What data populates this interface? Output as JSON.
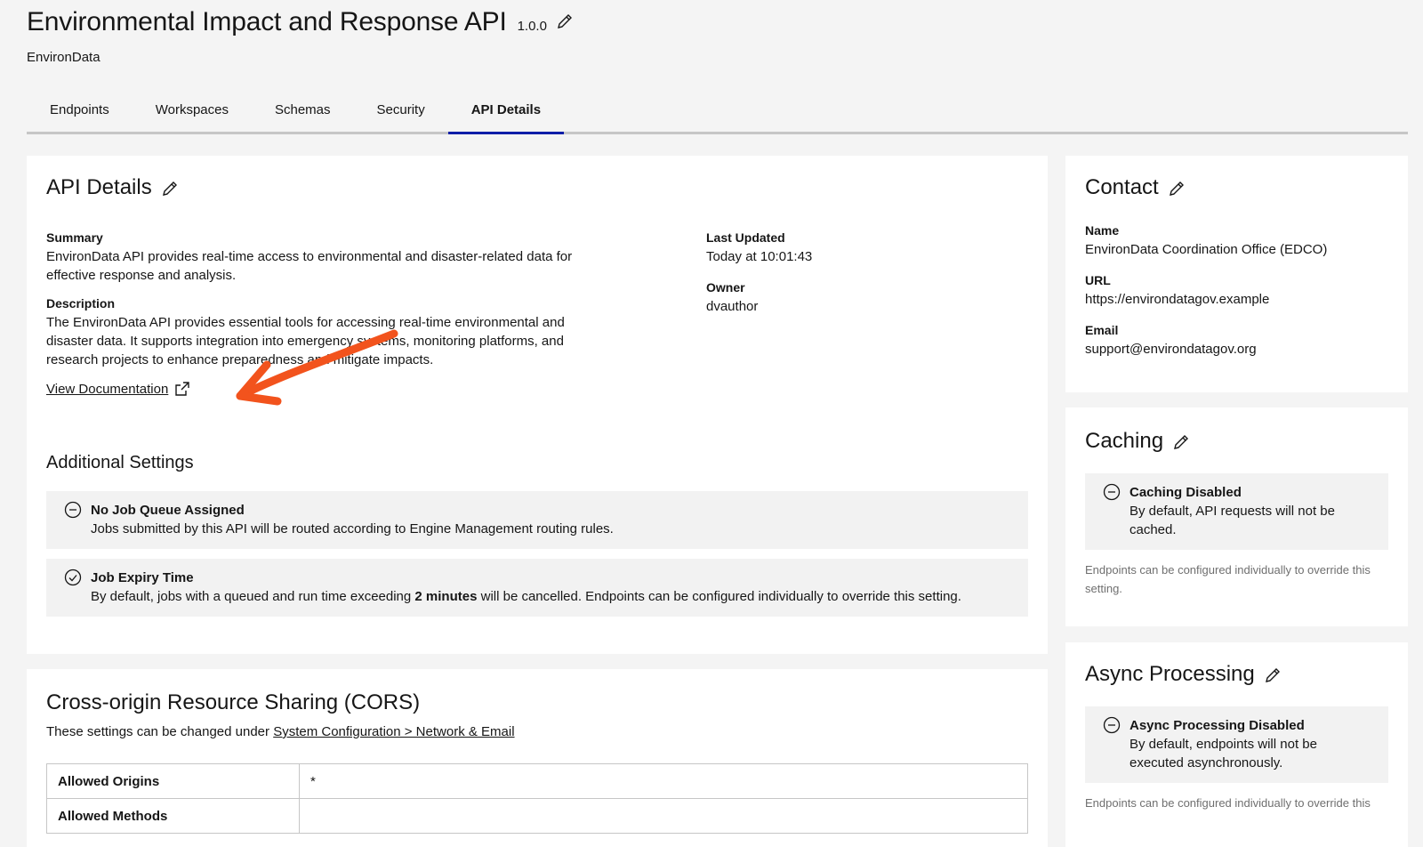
{
  "header": {
    "title": "Environmental Impact and Response API",
    "version": "1.0.0",
    "org": "EnvironData"
  },
  "tabs": [
    {
      "label": "Endpoints"
    },
    {
      "label": "Workspaces"
    },
    {
      "label": "Schemas"
    },
    {
      "label": "Security"
    },
    {
      "label": "API Details",
      "active": true
    }
  ],
  "details": {
    "title": "API Details",
    "summary_label": "Summary",
    "summary": "EnvironData API provides real-time access to environmental and disaster-related data for effective response and analysis.",
    "description_label": "Description",
    "description": "The EnvironData API provides essential tools for accessing real-time environmental and disaster data. It supports integration into emergency systems, monitoring platforms, and research projects to enhance preparedness and mitigate impacts.",
    "doc_link": "View Documentation",
    "last_updated_label": "Last Updated",
    "last_updated": "Today at 10:01:43",
    "owner_label": "Owner",
    "owner": "dvauthor"
  },
  "additional": {
    "title": "Additional Settings",
    "queue_title": "No Job Queue Assigned",
    "queue_desc": "Jobs submitted by this API will be routed according to Engine Management routing rules.",
    "expiry_title": "Job Expiry Time",
    "expiry_pre": "By default, jobs with a queued and run time exceeding ",
    "expiry_bold": "2 minutes",
    "expiry_post": " will be cancelled. Endpoints can be configured individually to override this setting."
  },
  "cors": {
    "title": "Cross-origin Resource Sharing (CORS)",
    "note_pre": "These settings can be changed under ",
    "note_link": "System Configuration > Network & Email",
    "rows": [
      {
        "label": "Allowed Origins",
        "value": "*"
      },
      {
        "label": "Allowed Methods",
        "value": ""
      }
    ]
  },
  "contact": {
    "title": "Contact",
    "name_label": "Name",
    "name": "EnvironData Coordination Office (EDCO)",
    "url_label": "URL",
    "url": "https://environdatagov.example",
    "email_label": "Email",
    "email": "support@environdatagov.org"
  },
  "caching": {
    "title": "Caching",
    "status": "Caching Disabled",
    "desc": "By default, API requests will not be cached.",
    "note": "Endpoints can be configured individually to override this setting."
  },
  "async": {
    "title": "Async Processing",
    "status": "Async Processing Disabled",
    "desc": "By default, endpoints will not be executed asynchronously.",
    "note": "Endpoints can be configured individually to override this"
  },
  "colors": {
    "accent": "#0f1ea8",
    "arrow": "#f2531d"
  },
  "icons": [
    "pencil-icon",
    "external-link-icon",
    "minus-circle-icon",
    "check-circle-icon"
  ]
}
